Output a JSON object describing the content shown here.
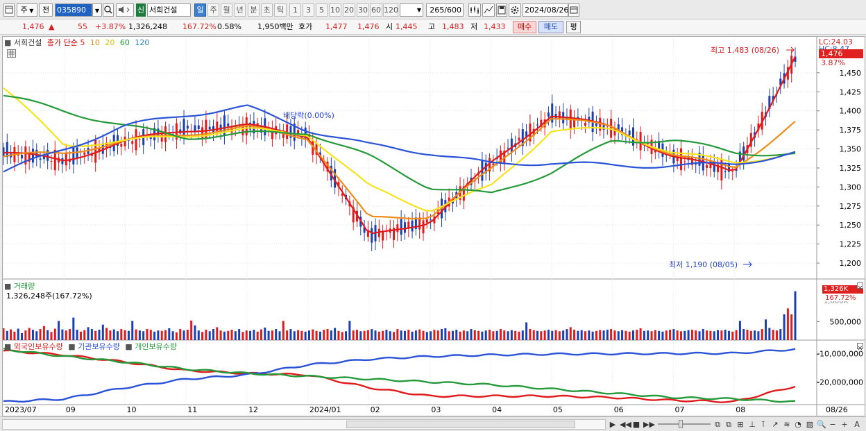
{
  "toolbar": {
    "market_label": "주",
    "prev_label": "전",
    "code_value": "035890",
    "new_badge": "신",
    "stock_name": "서희건설",
    "periods": [
      "일",
      "주",
      "월",
      "년",
      "분",
      "초",
      "틱"
    ],
    "active_period": "일",
    "intervals": [
      "1",
      "3",
      "5",
      "10",
      "20",
      "30",
      "60",
      "120"
    ],
    "count_value": "265",
    "count_max": "/600",
    "date_value": "2024/08/26"
  },
  "quote": {
    "price": "1,476",
    "arrow": "▲",
    "change": "55",
    "change_pct": "+3.87%",
    "volume": "1,326,248",
    "volume_ratio": "167.72%",
    "turnover": "0.58%",
    "amount": "1,950백만",
    "ask_label": "호가",
    "ask1": "1,477",
    "bid1": "1,476",
    "open_label": "시",
    "open": "1,445",
    "high_label": "고",
    "high": "1,483",
    "low_label": "저",
    "low": "1,433",
    "buy_label": "매수",
    "sell_label": "매도",
    "avg_label": "평"
  },
  "price_pane": {
    "title": "서희건설",
    "ma_label": "종가 단순",
    "ma_periods": [
      "5",
      "10",
      "20",
      "60",
      "120"
    ],
    "ma_colors": [
      "#e01b1b",
      "#f08c1a",
      "#f5e31c",
      "#259a3a",
      "#2a53d8"
    ],
    "lc_label": "LC:24.03",
    "hc_label": "HC:8.47",
    "last_price_tag": "1,476",
    "last_pct_tag": "3.87%",
    "high_note": "최고 1,483 (08/26)",
    "low_note": "최저 1,190 (08/05)",
    "dividend_note": "배당락(0.00%)",
    "y_ticks": [
      "1,450",
      "1,425",
      "1,400",
      "1,375",
      "1,350",
      "1,325",
      "1,300",
      "1,275",
      "1,250",
      "1,225",
      "1,200"
    ]
  },
  "volume_pane": {
    "title": "거래량",
    "value_label": "1,326,248주(167.72%)",
    "tag_value": "1,326K",
    "tag_pct": "167.72%",
    "ghost_tick": "1,000K",
    "y_ticks": [
      "500,000"
    ]
  },
  "holding_pane": {
    "series": [
      "외국인보유수량",
      "기관보유수량",
      "개인보유수량"
    ],
    "series_colors": [
      "#e01b1b",
      "#2a53d8",
      "#259a3a"
    ],
    "y_ticks": [
      "-10,000,000",
      "-20,000,000"
    ]
  },
  "x_axis": {
    "labels": [
      "2023/07",
      "09",
      "10",
      "11",
      "12",
      "2024/01",
      "02",
      "03",
      "04",
      "05",
      "06",
      "07",
      "08"
    ],
    "current_label": "08/26"
  },
  "chart_data": [
    {
      "type": "line",
      "title": "서희건설",
      "xlabel": "",
      "ylabel": "",
      "x": [
        "2023/07",
        "09",
        "10",
        "11",
        "12",
        "2024/01",
        "02",
        "03",
        "04",
        "05",
        "06",
        "07",
        "08",
        "08/26"
      ],
      "series": [
        {
          "name": "5",
          "values": [
            1345,
            1335,
            1360,
            1375,
            1380,
            1368,
            1235,
            1255,
            1330,
            1395,
            1378,
            1340,
            1320,
            1470
          ]
        },
        {
          "name": "10",
          "values": [
            1340,
            1345,
            1360,
            1370,
            1378,
            1365,
            1258,
            1262,
            1322,
            1392,
            1378,
            1342,
            1325,
            1385
          ]
        },
        {
          "name": "20",
          "values": [
            1430,
            1355,
            1360,
            1368,
            1375,
            1370,
            1300,
            1270,
            1300,
            1375,
            1375,
            1345,
            1332,
            1345
          ]
        },
        {
          "name": "60",
          "values": [
            1420,
            1400,
            1380,
            1365,
            1370,
            1372,
            1340,
            1300,
            1290,
            1320,
            1360,
            1362,
            1345,
            1343
          ]
        },
        {
          "name": "120",
          "values": [
            1320,
            1350,
            1380,
            1395,
            1405,
            1375,
            1355,
            1345,
            1330,
            1332,
            1328,
            1328,
            1330,
            1345
          ]
        }
      ],
      "ylim": [
        1180,
        1490
      ],
      "high": {
        "value": 1483,
        "date": "08/26"
      },
      "low": {
        "value": 1190,
        "date": "08/05"
      }
    },
    {
      "type": "bar",
      "title": "거래량",
      "xlabel": "",
      "ylabel": "",
      "last_value": 1326248,
      "values_k": [
        320,
        250,
        290,
        230,
        310,
        190,
        260,
        330,
        280,
        240,
        300,
        380,
        270,
        220,
        310,
        520,
        290,
        260,
        300,
        610,
        280,
        230,
        270,
        350,
        300,
        250,
        280,
        420,
        330,
        260,
        290,
        240,
        300,
        270,
        250,
        520,
        290,
        260,
        240,
        300,
        280,
        230,
        260,
        250,
        270,
        320,
        240,
        210,
        300,
        260,
        280,
        530,
        400,
        260,
        220,
        280,
        240,
        300,
        350,
        260,
        230,
        250,
        280,
        240,
        300,
        220,
        260,
        250,
        280,
        230,
        290,
        340,
        250,
        260,
        300,
        240,
        520,
        260,
        300,
        240,
        270,
        250,
        230,
        260,
        290,
        250,
        230,
        280,
        300,
        260,
        330,
        250,
        220,
        240,
        520,
        260,
        280,
        240,
        250,
        270,
        300,
        260,
        230,
        250,
        280,
        240,
        220,
        300,
        260,
        250,
        280,
        230,
        260,
        290,
        250,
        220,
        240,
        280,
        260,
        300,
        320,
        240,
        250,
        280,
        230,
        260,
        240,
        300,
        270,
        250,
        230,
        260,
        280,
        240,
        250,
        300,
        260,
        240,
        270,
        250,
        230,
        260,
        480,
        300,
        270,
        250,
        240,
        260,
        280,
        250,
        270,
        240,
        260,
        300,
        350,
        280,
        250,
        270,
        240,
        260,
        230,
        250,
        270,
        260,
        280,
        300,
        260,
        240,
        270,
        250,
        230,
        260,
        280,
        320,
        250,
        260,
        240,
        270,
        250,
        230,
        260,
        280,
        300,
        260,
        240,
        250,
        270,
        280,
        260,
        240,
        300,
        260,
        250,
        240,
        270,
        260,
        280,
        250,
        230,
        270,
        520,
        300,
        280,
        250,
        260,
        240,
        300,
        560,
        330,
        280,
        260,
        300,
        700,
        860,
        700,
        1326
      ]
    },
    {
      "type": "line",
      "title": "",
      "xlabel": "",
      "ylabel": "",
      "x": [
        "2023/07",
        "09",
        "10",
        "11",
        "12",
        "2024/01",
        "02",
        "03",
        "04",
        "05",
        "06",
        "07",
        "08",
        "08/26"
      ],
      "series": [
        {
          "name": "외국인보유수량",
          "values": [
            -9000000,
            -10500000,
            -13000000,
            -16000000,
            -17000000,
            -17500000,
            -22000000,
            -25000000,
            -25000000,
            -25000000,
            -25500000,
            -26500000,
            -27000000,
            -21500000
          ]
        },
        {
          "name": "기관보유수량",
          "values": [
            -27000000,
            -26000000,
            -22000000,
            -19000000,
            -17500000,
            -14000000,
            -12000000,
            -11000000,
            -10500000,
            -10200000,
            -10100000,
            -10000000,
            -9900000,
            -8500000
          ]
        },
        {
          "name": "개인보유수량",
          "values": [
            -8500000,
            -11000000,
            -13000000,
            -15500000,
            -17000000,
            -18000000,
            -19000000,
            -20000000,
            -21000000,
            -22500000,
            -24000000,
            -25500000,
            -26000000,
            -27000000
          ]
        }
      ],
      "ylim": [
        -28000000,
        -6000000
      ]
    }
  ]
}
